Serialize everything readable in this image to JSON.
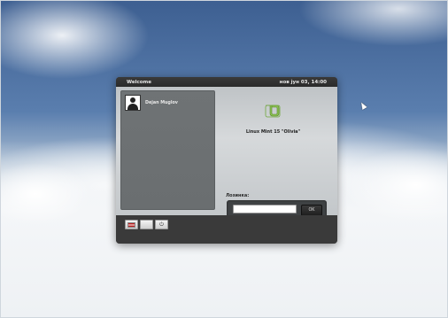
{
  "window": {
    "title": "Welcome",
    "datetime": "нов јун 03, 14:00"
  },
  "users": [
    {
      "name": "Dejan Muglov"
    }
  ],
  "system": {
    "os_name": "Linux Mint 15 \"Olivia\""
  },
  "login": {
    "password_label": "Лозинка:",
    "password_value": "",
    "ok_label": "OK"
  },
  "toolbar": {
    "buttons": [
      {
        "icon": "flag-icon"
      },
      {
        "icon": "blank-icon"
      },
      {
        "icon": "power-icon"
      }
    ]
  },
  "colors": {
    "mint_green": "#8cc152",
    "dialog_bg": "#3b3b3b"
  }
}
